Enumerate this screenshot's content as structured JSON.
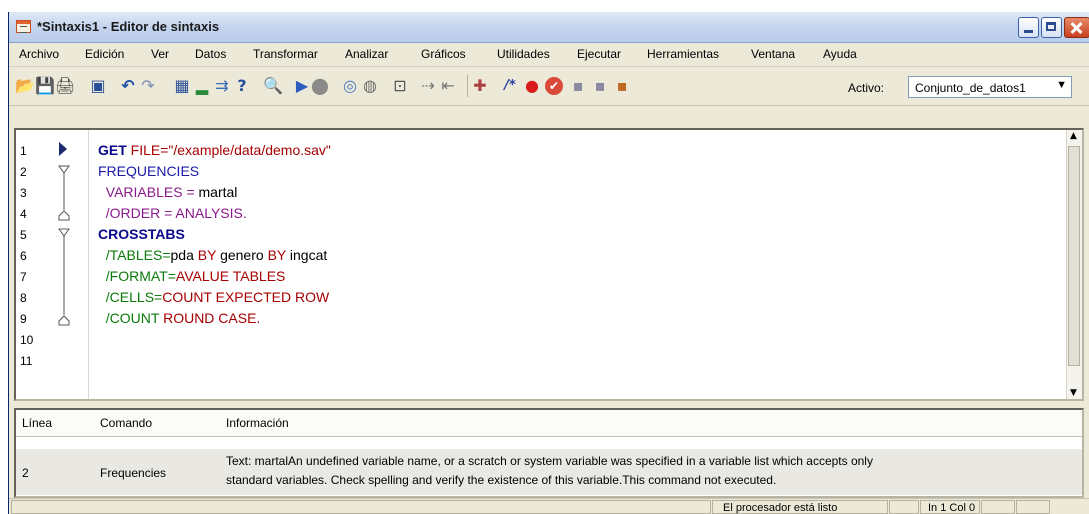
{
  "window": {
    "title": "*Sintaxis1 - Editor de sintaxis"
  },
  "menubar": {
    "items": [
      "Archivo",
      "Edición",
      "Ver",
      "Datos",
      "Transformar",
      "Analizar",
      "Gráficos",
      "Utilidades",
      "Ejecutar",
      "Herramientas",
      "Ventana",
      "Ayuda"
    ]
  },
  "toolbar": {
    "active_label": "Activo:",
    "dataset_value": "Conjunto_de_datos1",
    "dataset_arrow": "▼",
    "icons": {
      "open": "📂",
      "save": "💾",
      "print": "🖨",
      "dialog": "▣",
      "undo": "↶",
      "redo": "↷",
      "data_editor": "▦",
      "chart": "▂",
      "insert": "⇉",
      "varinfo": "?",
      "find": "🔍",
      "run": "▶",
      "stop": "⬤",
      "bookmark": "◎",
      "step": "◍",
      "format": "⊡",
      "syntax": "⇢",
      "prev": "⇤",
      "comment": "/*",
      "breakpoint": "●",
      "clear": "✔",
      "b1": "▪",
      "b2": "▪",
      "b3": "▪"
    }
  },
  "editor": {
    "line_numbers": [
      "1",
      "2",
      "3",
      "4",
      "5",
      "6",
      "7",
      "8",
      "9",
      "10",
      "11"
    ],
    "lines": {
      "l1_cmd": "GET",
      "l1_rest": " FILE=\"/example/data/demo.sav\"",
      "l2_cmd": "FREQUENCIES",
      "l3_a": "  VARIABLES = ",
      "l3_b": "martal",
      "l4": "  /ORDER = ANALYSIS.",
      "l5_cmd": "CROSSTABS",
      "l6_a": "  /TABLES=",
      "l6_b": "pda ",
      "l6_c": "BY",
      "l6_d": " genero ",
      "l6_e": "BY",
      "l6_f": " ingcat",
      "l7_a": "  /FORMAT=",
      "l7_b": "AVALUE TABLES",
      "l8_a": "  /CELLS=",
      "l8_b": "COUNT EXPECTED ROW",
      "l9_a": "  /COUNT ",
      "l9_b": "ROUND CASE."
    }
  },
  "errors": {
    "headers": {
      "line": "Línea",
      "command": "Comando",
      "info": "Información"
    },
    "rows": [
      {
        "line": "2",
        "command": "Frequencies",
        "info_1": "Text: martalAn undefined variable name, or a scratch or system variable was specified in a variable list which accepts only",
        "info_2": "standard variables.  Check spelling and verify the existence of this variable.This command not executed."
      }
    ]
  },
  "statusbar": {
    "processor": "El procesador está listo",
    "position": "In 1 Col 0"
  },
  "colors": {
    "keyword_blue": "#0a0a8c",
    "string_red": "#a80000",
    "subcommand_purple": "#8a1a8a",
    "subcommand_green": "#0a7a0a"
  }
}
